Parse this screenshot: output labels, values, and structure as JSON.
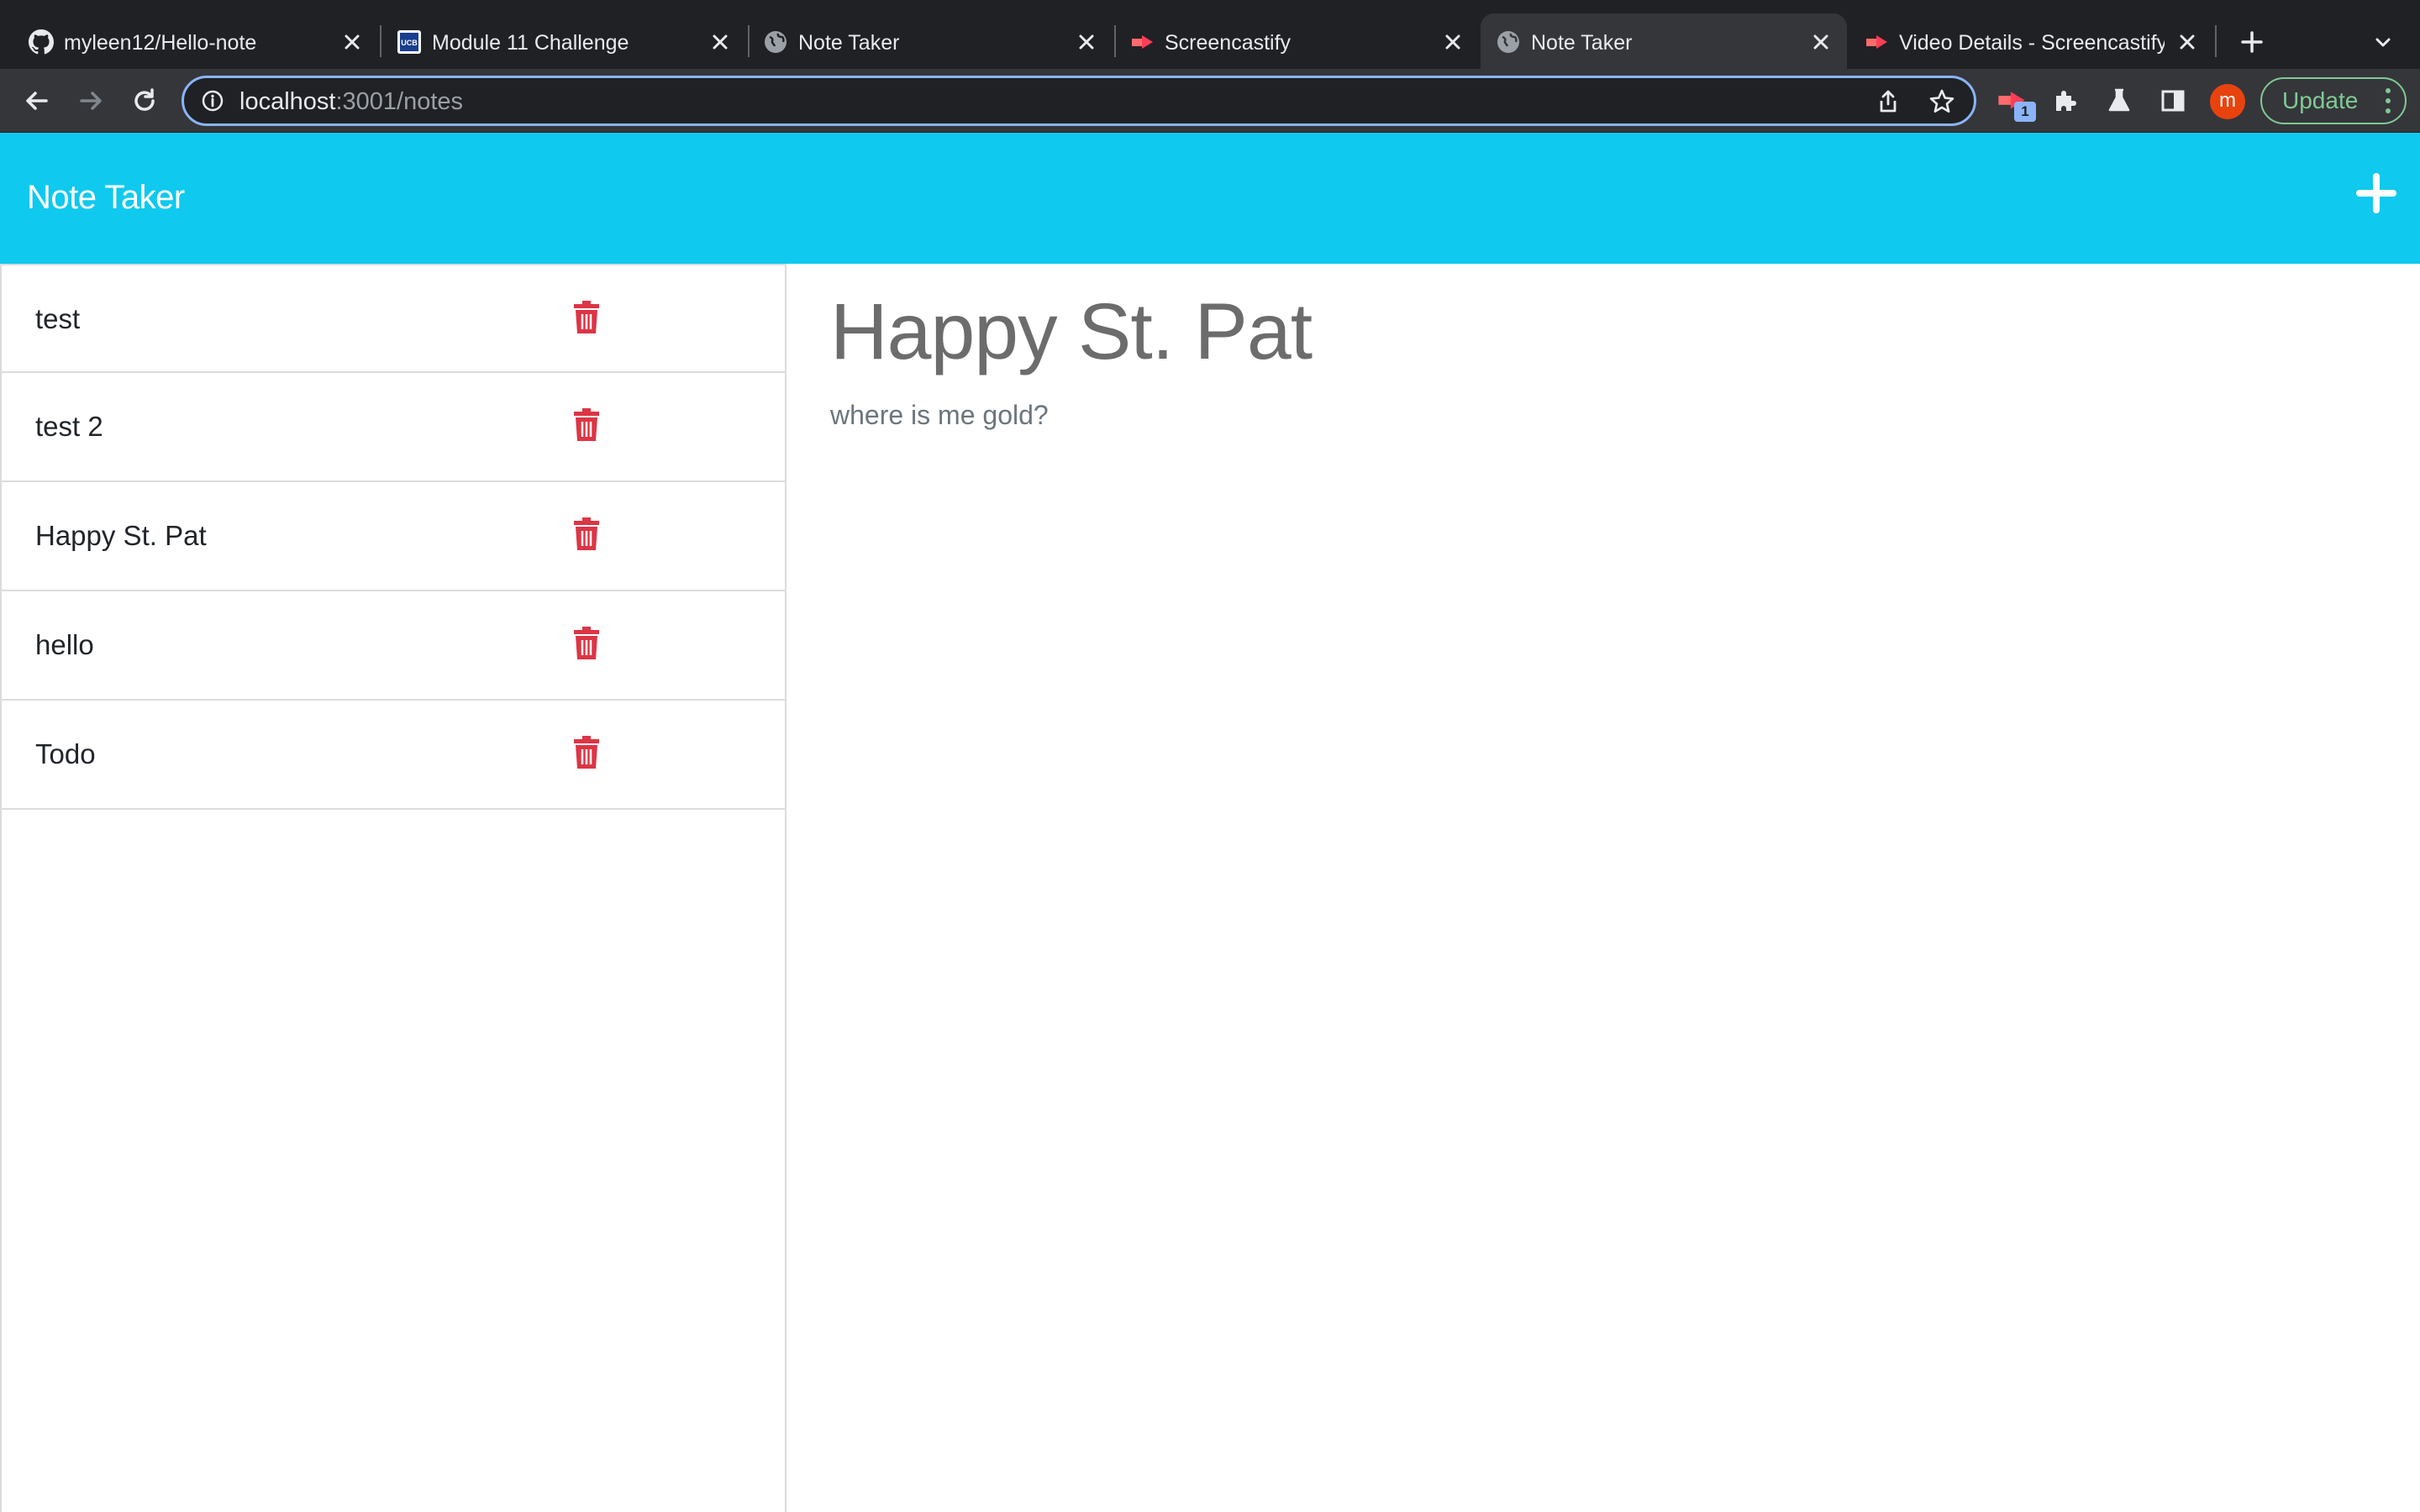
{
  "browser": {
    "tabs": [
      {
        "title": "myleen12/Hello-note",
        "favicon": "github-icon",
        "active": false
      },
      {
        "title": "Module 11 Challenge",
        "favicon": "ucb-bootcamp-icon",
        "active": false
      },
      {
        "title": "Note Taker",
        "favicon": "globe-icon",
        "active": false
      },
      {
        "title": "Screencastify",
        "favicon": "screencastify-icon",
        "active": false
      },
      {
        "title": "Note Taker",
        "favicon": "globe-icon",
        "active": true
      },
      {
        "title": "Video Details - Screencastify",
        "favicon": "screencastify-icon",
        "active": false
      }
    ],
    "address": {
      "host": "localhost",
      "path": ":3001/notes"
    },
    "extension_badge": "1",
    "profile_initial": "m",
    "update_label": "Update",
    "accent_color": "#8ab4f8"
  },
  "app": {
    "brand": "Note Taker",
    "brand_color": "#0fc9ee",
    "delete_color": "#dc3545",
    "notes": [
      {
        "title": "test"
      },
      {
        "title": "test 2"
      },
      {
        "title": "Happy St. Pat"
      },
      {
        "title": "hello"
      },
      {
        "title": "Todo"
      }
    ],
    "active_note": {
      "title": "Happy St. Pat",
      "text": "where is me gold?"
    }
  }
}
